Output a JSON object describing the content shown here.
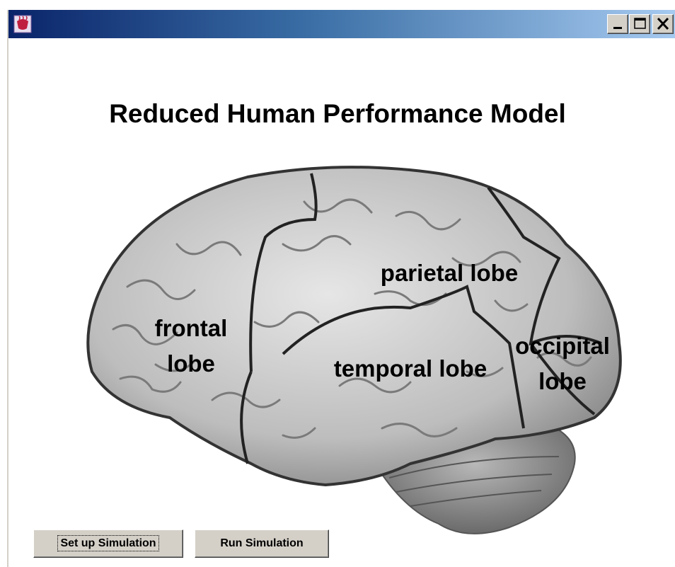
{
  "window": {
    "icon": "java-cup-icon",
    "controls": {
      "minimize": "minimize-icon",
      "maximize": "maximize-icon",
      "close": "close-icon"
    }
  },
  "main": {
    "title": "Reduced Human Performance Model",
    "brain_image": "brain-lateral-view",
    "labels": {
      "frontal_line1": "frontal",
      "frontal_line2": "lobe",
      "parietal": "parietal lobe",
      "temporal": "temporal lobe",
      "occipital_line1": "occipital",
      "occipital_line2": "lobe"
    }
  },
  "buttons": {
    "setup": "Set up Simulation",
    "run": "Run Simulation"
  },
  "colors": {
    "titlebar_start": "#0a246a",
    "titlebar_end": "#a6caf0",
    "button_face": "#d4d0c8"
  }
}
